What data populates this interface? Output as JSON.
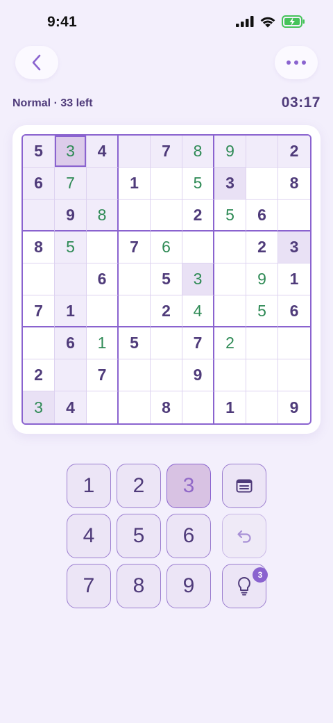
{
  "status_bar": {
    "time": "9:41"
  },
  "header": {
    "back_icon": "chevron-left-icon",
    "more_icon": "more-horizontal-icon",
    "level_text": "Normal · 33 left",
    "timer": "03:17"
  },
  "board": {
    "rows": [
      [
        "5",
        "3",
        "4",
        "",
        "7",
        "8",
        "9",
        "",
        "2"
      ],
      [
        "6",
        "7",
        "",
        "1",
        "",
        "5",
        "3",
        "",
        "8"
      ],
      [
        "",
        "9",
        "8",
        "",
        "",
        "2",
        "5",
        "6",
        ""
      ],
      [
        "8",
        "5",
        "",
        "7",
        "6",
        "",
        "",
        "2",
        "3"
      ],
      [
        "",
        "",
        "6",
        "",
        "5",
        "3",
        "",
        "9",
        "1"
      ],
      [
        "7",
        "1",
        "",
        "",
        "2",
        "4",
        "",
        "5",
        "6"
      ],
      [
        "",
        "6",
        "1",
        "5",
        "",
        "7",
        "2",
        "",
        ""
      ],
      [
        "2",
        "",
        "7",
        "",
        "",
        "9",
        "",
        "",
        ""
      ],
      [
        "3",
        "4",
        "",
        "",
        "8",
        "",
        "1",
        "",
        "9"
      ]
    ],
    "entered": [
      "0,1",
      "0,5",
      "0,6",
      "1,1",
      "1,5",
      "2,2",
      "2,6",
      "3,1",
      "3,4",
      "4,5",
      "4,7",
      "5,5",
      "5,7",
      "6,2",
      "6,6",
      "8,0"
    ],
    "selected": "0,1",
    "highlighted_value": "3",
    "colors": {
      "given": "#4f3b7a",
      "entered": "#2e8a55",
      "accent": "#8a63cf",
      "selected_bg": "#dccbea"
    }
  },
  "keypad": {
    "numbers": [
      "1",
      "2",
      "3",
      "4",
      "5",
      "6",
      "7",
      "8",
      "9"
    ],
    "active_number": "3",
    "tools": {
      "notes_icon": "notes-icon",
      "undo_icon": "undo-icon",
      "hint_icon": "lightbulb-icon",
      "hint_count": "3"
    }
  }
}
